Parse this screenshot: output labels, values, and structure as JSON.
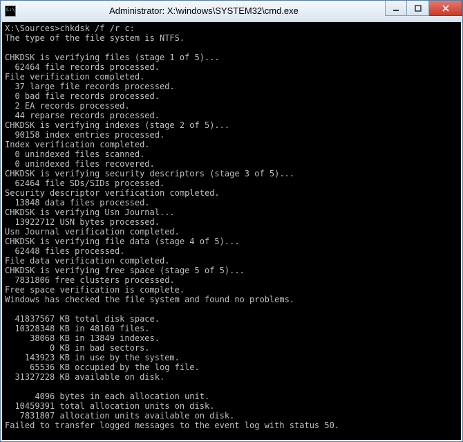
{
  "titlebar": {
    "title": "Administrator: X:\\windows\\SYSTEM32\\cmd.exe"
  },
  "prompt": "X:\\Sources>",
  "command": "chkdsk /f /r c:",
  "lines": [
    "X:\\Sources>chkdsk /f /r c:",
    "The type of the file system is NTFS.",
    "",
    "CHKDSK is verifying files (stage 1 of 5)...",
    "  62464 file records processed.",
    "File verification completed.",
    "  37 large file records processed.",
    "  0 bad file records processed.",
    "  2 EA records processed.",
    "  44 reparse records processed.",
    "CHKDSK is verifying indexes (stage 2 of 5)...",
    "  90158 index entries processed.",
    "Index verification completed.",
    "  0 unindexed files scanned.",
    "  0 unindexed files recovered.",
    "CHKDSK is verifying security descriptors (stage 3 of 5)...",
    "  62464 file SDs/SIDs processed.",
    "Security descriptor verification completed.",
    "  13848 data files processed.",
    "CHKDSK is verifying Usn Journal...",
    "  13922712 USN bytes processed.",
    "Usn Journal verification completed.",
    "CHKDSK is verifying file data (stage 4 of 5)...",
    "  62448 files processed.",
    "File data verification completed.",
    "CHKDSK is verifying free space (stage 5 of 5)...",
    "  7831806 free clusters processed.",
    "Free space verification is complete.",
    "Windows has checked the file system and found no problems.",
    "",
    "  41837567 KB total disk space.",
    "  10328348 KB in 48160 files.",
    "     38068 KB in 13849 indexes.",
    "         0 KB in bad sectors.",
    "    143923 KB in use by the system.",
    "     65536 KB occupied by the log file.",
    "  31327228 KB available on disk.",
    "",
    "      4096 bytes in each allocation unit.",
    "  10459391 total allocation units on disk.",
    "   7831807 allocation units available on disk.",
    "Failed to transfer logged messages to the event log with status 50."
  ]
}
